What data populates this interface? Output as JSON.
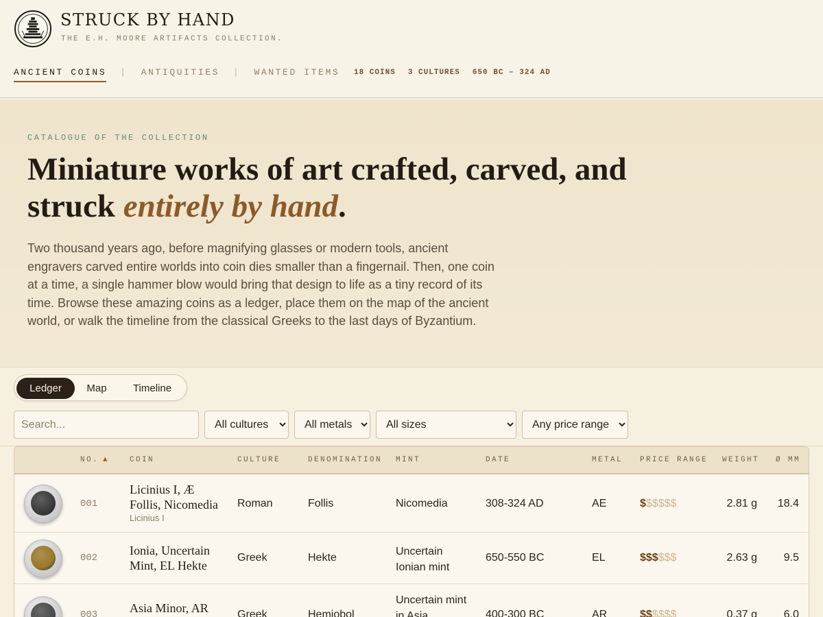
{
  "brand": {
    "title": "STRUCK BY HAND",
    "subtitle": "THE E.H. MOORE ARTIFACTS COLLECTION."
  },
  "nav": {
    "items": [
      {
        "label": "ANCIENT COINS",
        "active": true
      },
      {
        "label": "ANTIQUITIES",
        "active": false
      },
      {
        "label": "WANTED ITEMS",
        "active": false
      }
    ],
    "stats": [
      "18 COINS",
      "3 CULTURES",
      "650 BC – 324 AD"
    ]
  },
  "hero": {
    "eyebrow": "CATALOGUE OF THE COLLECTION",
    "title_line1": "Miniature works of art crafted, carved, and",
    "title_line2_plain": "struck ",
    "title_line2_emphasis": "entirely by hand",
    "title_line2_end": ".",
    "body": "Two thousand years ago, before magnifying glasses or modern tools, ancient engravers carved entire worlds into coin dies smaller than a fingernail. Then, one coin at a time, a single hammer blow would bring that design to life as a tiny record of its time. Browse these amazing coins as a ledger, place them on the map of the ancient world, or walk the timeline from the classical Greeks to the last days of Byzantium."
  },
  "views": {
    "options": [
      "Ledger",
      "Map",
      "Timeline"
    ],
    "active": "Ledger"
  },
  "filters": {
    "search_placeholder": "Search...",
    "culture": "All cultures",
    "metal": "All metals",
    "size": "All sizes",
    "price": "Any price range"
  },
  "table": {
    "columns": [
      "NO.",
      "COIN",
      "CULTURE",
      "DENOMINATION",
      "MINT",
      "DATE",
      "METAL",
      "PRICE RANGE",
      "WEIGHT",
      "Ø MM"
    ],
    "sort_icon": "triangle-up",
    "rows": [
      {
        "no": "001",
        "coin": "Licinius I, Æ Follis, Nicomedia",
        "coin_sub": "Licinius I",
        "culture": "Roman",
        "denomination": "Follis",
        "mint": "Nicomedia",
        "date": "308-324 AD",
        "metal": "AE",
        "price_level": 1,
        "price_filled": "$",
        "price_empty": "$$$$$",
        "weight": "2.81 g",
        "diameter": "18.4",
        "coin_color": "#3b3b3b"
      },
      {
        "no": "002",
        "coin": "Ionia, Uncertain Mint, EL Hekte",
        "coin_sub": "",
        "culture": "Greek",
        "denomination": "Hekte",
        "mint": "Uncertain Ionian mint",
        "date": "650-550 BC",
        "metal": "EL",
        "price_level": 3,
        "price_filled": "$$$",
        "price_empty": "$$$",
        "weight": "2.63 g",
        "diameter": "9.5",
        "coin_color": "#9a7a2a"
      },
      {
        "no": "003",
        "coin": "Asia Minor, AR",
        "coin_sub": "",
        "culture": "Greek",
        "denomination": "Hemiobol",
        "mint": "Uncertain mint in Asia",
        "date": "400-300 BC",
        "metal": "AR",
        "price_level": 2,
        "price_filled": "$$",
        "price_empty": "$$$$",
        "weight": "0.37 g",
        "diameter": "6.0",
        "coin_color": "#4a4a4a"
      }
    ]
  }
}
